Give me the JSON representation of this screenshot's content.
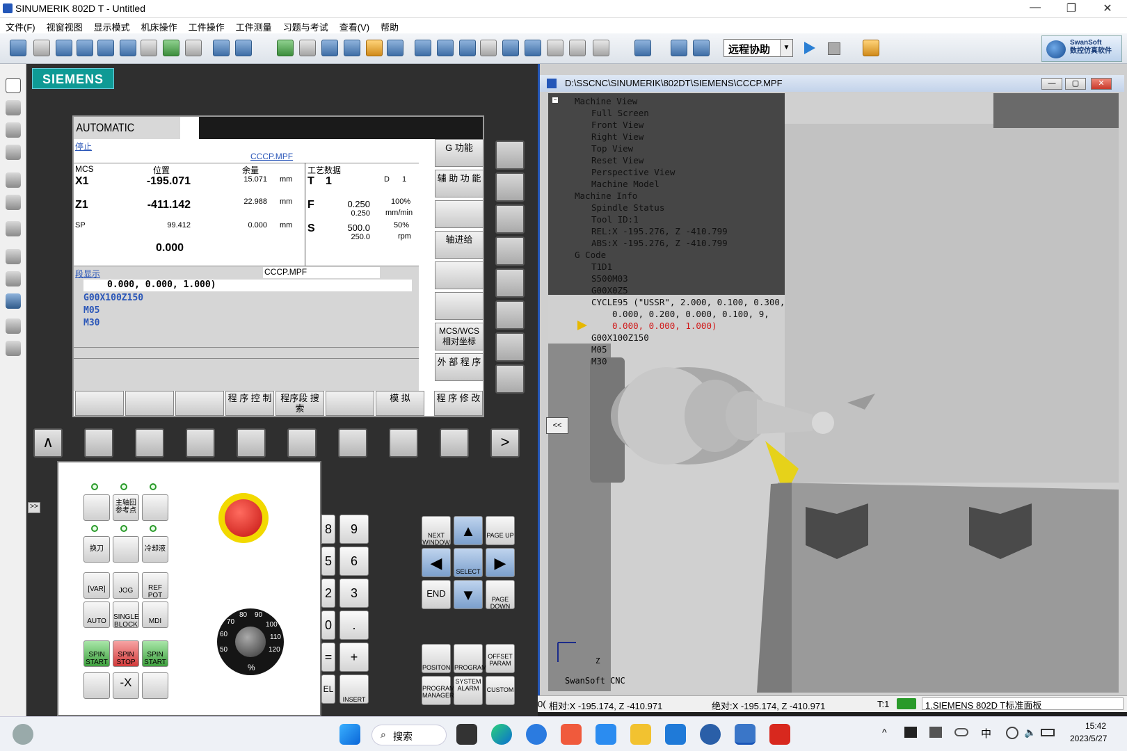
{
  "window": {
    "title": "SINUMERIK 802D T - Untitled",
    "minimize": "—",
    "restore": "❐",
    "close": "✕"
  },
  "menu": [
    "文件(F)",
    "视窗视图",
    "显示模式",
    "机床操作",
    "工件操作",
    "工件测量",
    "习题与考试",
    "查看(V)",
    "帮助"
  ],
  "toolbar": {
    "remote_label": "远程协助",
    "brand_line1": "SwanSoft",
    "brand_line2": "数控仿真软件"
  },
  "siemens_logo": "SIEMENS",
  "cnc": {
    "mode": "AUTOMATIC",
    "state": "停止",
    "program": "CCCP.MPF",
    "headers": {
      "mcs": "MCS",
      "pos": "位置",
      "remain": "余量",
      "tech": "工艺数据"
    },
    "axes": [
      {
        "name": "X1",
        "pos": "-195.071",
        "remain": "15.071",
        "unit": "mm"
      },
      {
        "name": "Z1",
        "pos": "-411.142",
        "remain": "22.988",
        "unit": "mm"
      },
      {
        "name": "SP",
        "pos": "99.412",
        "remain": "0.000",
        "unit": "mm"
      }
    ],
    "extra_value": "0.000",
    "tech": {
      "t_label": "T",
      "t_val": "1",
      "d_label": "D",
      "d_val": "1",
      "f_label": "F",
      "f_val1": "0.250",
      "f_val2": "0.250",
      "f_pct": "100%",
      "f_unit": "mm/min",
      "s_label": "S",
      "s_val1": "500.0",
      "s_val2": "250.0",
      "s_pct": "50%",
      "s_unit": "rpm"
    },
    "block_label": "段显示",
    "block_program": "CCCP.MPF",
    "block_current": "0.000, 0.000, 1.000)",
    "block_lines": [
      "G00X100Z150",
      "M05",
      "M30"
    ],
    "softkeys_right": [
      "G 功能",
      "辅 助 功 能",
      "",
      "轴进给",
      "",
      "",
      "MCS/WCS 相对坐标",
      "外 部 程 序"
    ],
    "softkeys_bottom": [
      "",
      "",
      "",
      "程 序 控 制",
      "程序段 搜 索",
      "",
      "模 拟",
      "程 序 修 改"
    ]
  },
  "machine_panel": {
    "spindle_ref": "主轴回 参考点",
    "tool_change": "换刀",
    "coolant": "冷却液",
    "var": "[VAR]",
    "jog": "JOG",
    "ref_pot": "REF POT",
    "auto": "AUTO",
    "single_block": "SINGLE BLOCK",
    "mdi": "MDI",
    "spin_start": "SPIN START",
    "spin_stop": "SPIN STOP",
    "spin_start2": "SPIN START",
    "minus_x": "-X",
    "override_label": "%",
    "override_values": [
      "50",
      "60",
      "70",
      "80",
      "90",
      "100",
      "110",
      "120"
    ]
  },
  "numpad": [
    "8",
    "9",
    "5",
    "6",
    "2",
    "3",
    "0",
    ".",
    "=",
    "+",
    "EL",
    "INSERT"
  ],
  "cursor_keys": {
    "next_window": "NEXT WINDOW",
    "page_up": "PAGE UP",
    "select": "SELECT",
    "end": "END",
    "page_down": "PAGE DOWN",
    "position": "POSITON",
    "program": "PROGRAM",
    "offset_param": "OFFSET PARAM",
    "program_manager": "PROGRAM MANAGER",
    "system_alarm": "SYSTEM ALARM",
    "custom": "CUSTOM"
  },
  "viewport": {
    "path": "D:\\SSCNC\\SINUMERIK\\802DT\\SIEMENS\\CCCP.MPF",
    "collapse": "<<",
    "watermark": "SwanSoft CNC",
    "axis_z": "Z"
  },
  "tree": [
    "Machine View",
    "Full Screen",
    "Front View",
    "Right View",
    "Top View",
    "Reset View",
    "Perspective View",
    "Machine Model",
    "Machine Info",
    "Spindle Status",
    "Tool ID:1",
    "REL:X -195.276, Z -410.799",
    "ABS:X -195.276, Z -410.799",
    "G Code",
    "T1D1",
    "S500M03",
    "G00X0Z5",
    "CYCLE95 (\"USSR\", 2.000, 0.100, 0.300,",
    "0.000, 0.200, 0.000, 0.100, 9,",
    "0.000, 0.000, 1.000)",
    "G00X100Z150",
    "M05",
    "M30"
  ],
  "status": {
    "prefix": "0(",
    "rel": "相对:X -195.174, Z -410.971",
    "abs": "绝对:X -195.174, Z -410.971",
    "tool": "T:1",
    "machine": "1.SIEMENS 802D T标准面板"
  },
  "taskbar": {
    "search": "搜索",
    "ime": "中",
    "time": "15:42",
    "date": "2023/5/27"
  },
  "colors": {
    "accent": "#2457b8",
    "siemens": "#0f9a95",
    "estop": "#e0201e",
    "tool_yellow": "#e6d21a"
  }
}
